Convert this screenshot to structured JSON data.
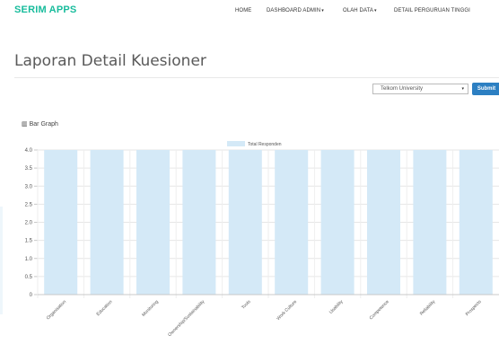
{
  "brand": "SERIM APPS",
  "nav": {
    "home": "HOME",
    "dashboard_admin": "DASHBOARD ADMIN",
    "olah_data": "OLAH DATA",
    "detail_perguruan": "DETAIL PERGURUAN TINGGI"
  },
  "page_title": "Laporan Detail Kuesioner",
  "filter": {
    "selected": "Telkom University",
    "submit_label": "Submit"
  },
  "graph_title": "Bar Graph",
  "colors": {
    "brand": "#18bc9c",
    "bar_fill": "#d4e9f7",
    "submit": "#2c7fc2"
  },
  "chart_data": {
    "type": "bar",
    "categories": [
      "Organisation",
      "Education",
      "Monitoring",
      "Ownership/Sustainability",
      "Tools",
      "Work Culture",
      "Usability",
      "Competence",
      "Reliability",
      "Prospects"
    ],
    "series": [
      {
        "name": "Total Responden",
        "values": [
          4,
          4,
          4,
          4,
          4,
          4,
          4,
          4,
          4,
          4
        ]
      }
    ],
    "y_ticks": [
      "0",
      "0.5",
      "1.0",
      "1.5",
      "2.0",
      "2.5",
      "3.0",
      "3.5",
      "4.0"
    ],
    "ylim": [
      0,
      4
    ],
    "grid": true,
    "legend_position": "top"
  }
}
